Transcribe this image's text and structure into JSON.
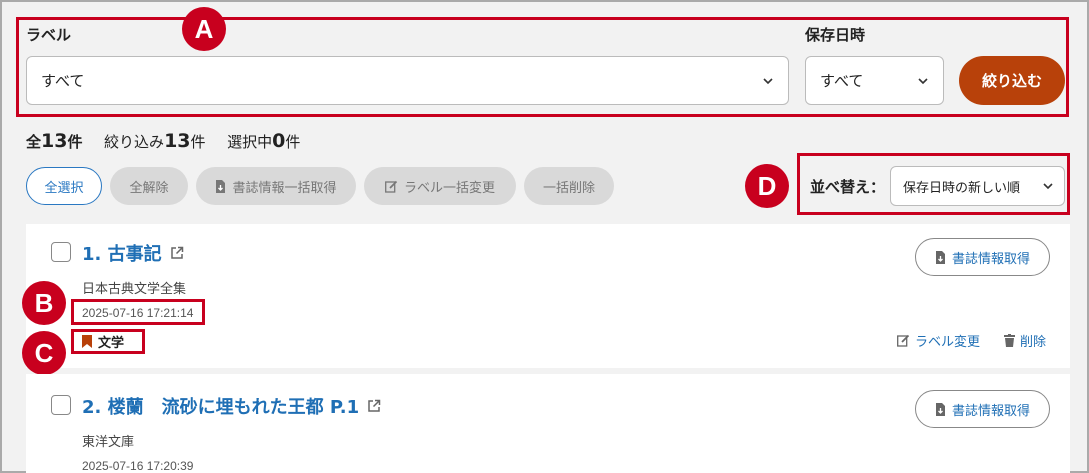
{
  "filter": {
    "label_field_label": "ラベル",
    "label_value": "すべて",
    "date_field_label": "保存日時",
    "date_value": "すべて",
    "apply_button": "絞り込む"
  },
  "markers": {
    "a": "A",
    "b": "B",
    "c": "C",
    "d": "D"
  },
  "counts": {
    "total_prefix": "全",
    "total": "13",
    "total_suffix": "件",
    "filtered_prefix": "絞り込み",
    "filtered": "13",
    "filtered_suffix": "件",
    "selected_prefix": "選択中",
    "selected": "0",
    "selected_suffix": "件"
  },
  "actions": {
    "select_all": "全選択",
    "deselect_all": "全解除",
    "bulk_fetch": "書誌情報一括取得",
    "bulk_label": "ラベル一括変更",
    "bulk_delete": "一括削除"
  },
  "sort": {
    "label": "並べ替え：",
    "value": "保存日時の新しい順"
  },
  "items": [
    {
      "title": "1.  古事記",
      "subtitle": "日本古典文学全集",
      "date": "2025-07-16 17:21:14",
      "tag": "文学",
      "fetch_button": "書誌情報取得",
      "change_label": "ラベル変更",
      "delete": "削除"
    },
    {
      "title": "2.  楼蘭　流砂に埋もれた王都 P.1",
      "subtitle": "東洋文庫",
      "date": "2025-07-16 17:20:39",
      "fetch_button": "書誌情報取得"
    }
  ],
  "colors": {
    "accent": "#b8410a",
    "link": "#1f6fb5",
    "annotation": "#c8001e"
  }
}
